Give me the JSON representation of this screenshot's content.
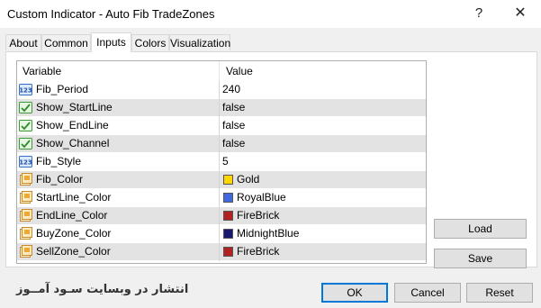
{
  "window": {
    "title": "Custom Indicator - Auto Fib TradeZones",
    "help_glyph": "?",
    "close_glyph": "✕"
  },
  "tabs": [
    {
      "label": "About",
      "active": false
    },
    {
      "label": "Common",
      "active": false
    },
    {
      "label": "Inputs",
      "active": true
    },
    {
      "label": "Colors",
      "active": false
    },
    {
      "label": "Visualization",
      "active": false
    }
  ],
  "grid": {
    "headers": {
      "variable": "Variable",
      "value": "Value"
    },
    "rows": [
      {
        "name": "Fib_Period",
        "value": "240",
        "type": "number"
      },
      {
        "name": "Show_StartLine",
        "value": "false",
        "type": "bool"
      },
      {
        "name": "Show_EndLine",
        "value": "false",
        "type": "bool"
      },
      {
        "name": "Show_Channel",
        "value": "false",
        "type": "bool"
      },
      {
        "name": "Fib_Style",
        "value": "5",
        "type": "number"
      },
      {
        "name": "Fib_Color",
        "value": "Gold",
        "type": "color",
        "color": "#ffd700"
      },
      {
        "name": "StartLine_Color",
        "value": "RoyalBlue",
        "type": "color",
        "color": "#4169e1"
      },
      {
        "name": "EndLine_Color",
        "value": "FireBrick",
        "type": "color",
        "color": "#b22222"
      },
      {
        "name": "BuyZone_Color",
        "value": "MidnightBlue",
        "type": "color",
        "color": "#191970"
      },
      {
        "name": "SellZone_Color",
        "value": "FireBrick",
        "type": "color",
        "color": "#b22222"
      }
    ]
  },
  "side_buttons": {
    "load": "Load",
    "save": "Save"
  },
  "footer": {
    "watermark": "انتشار در وبسایت سـود آمــوز",
    "ok": "OK",
    "cancel": "Cancel",
    "reset": "Reset"
  }
}
